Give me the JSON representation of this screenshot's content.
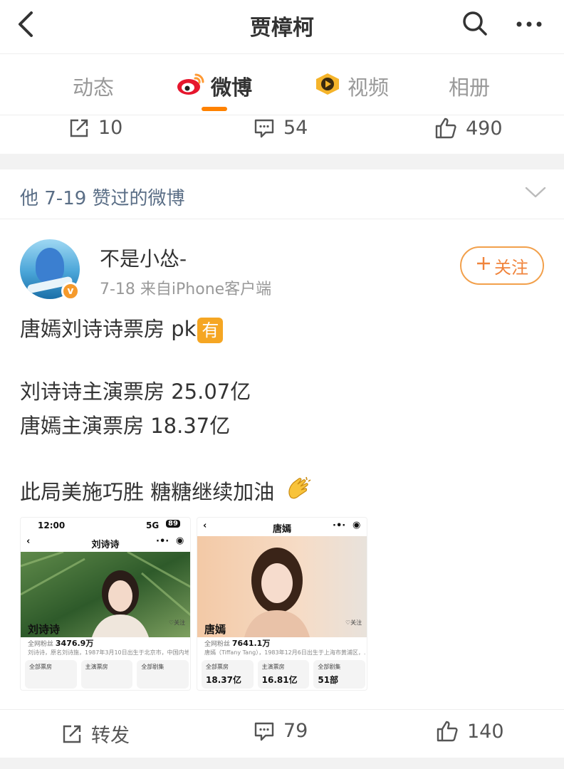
{
  "header": {
    "title": "贾樟柯"
  },
  "tabs": [
    {
      "label": "动态",
      "active": false
    },
    {
      "label": "微博",
      "active": true,
      "icon": "weibo-logo-icon"
    },
    {
      "label": "视频",
      "active": false,
      "icon": "video-play-icon"
    },
    {
      "label": "相册",
      "active": false
    }
  ],
  "accent_color": "#ff8200",
  "prev_post_actions": {
    "repost_count": "10",
    "comment_count": "54",
    "like_count": "490"
  },
  "liked_section": {
    "label": "他 7-19 赞过的微博"
  },
  "post": {
    "author": "不是小怂-",
    "meta": "7-18  来自iPhone客户端",
    "follow_label": "关注",
    "lines": [
      "唐嫣刘诗诗票房 pk",
      "刘诗诗主演票房 25.07亿",
      "唐嫣主演票房 18.37亿",
      "此局美施巧胜 糖糖继续加油"
    ],
    "inline_tag": "有",
    "images": [
      {
        "status_time": "12:00",
        "status_signal": "5G",
        "status_battery": "89",
        "page_title": "刘诗诗",
        "name": "刘诗诗",
        "fans_label": "全网粉丝",
        "fans_value": "3476.9万",
        "bio": "刘诗诗，原名刘诗施，1987年3月10日出生于北京市，中国内地...",
        "follow_label": "关注",
        "stats": [
          {
            "label": "全部票房",
            "value": ""
          },
          {
            "label": "主演票房",
            "value": ""
          },
          {
            "label": "全部剧集",
            "value": ""
          }
        ]
      },
      {
        "status_time": "",
        "status_signal": "",
        "status_battery": "",
        "page_title": "唐嫣",
        "name": "唐嫣",
        "fans_label": "全网粉丝",
        "fans_value": "7641.1万",
        "bio": "唐嫣（Tiffany Tang），1983年12月6日出生于上海市黄浦区，...",
        "follow_label": "关注",
        "stats": [
          {
            "label": "全部票房",
            "value": "18.37亿"
          },
          {
            "label": "主演票房",
            "value": "16.81亿"
          },
          {
            "label": "全部剧集",
            "value": "51部"
          }
        ]
      }
    ],
    "actions": {
      "repost_label": "转发",
      "comment_count": "79",
      "like_count": "140"
    }
  }
}
